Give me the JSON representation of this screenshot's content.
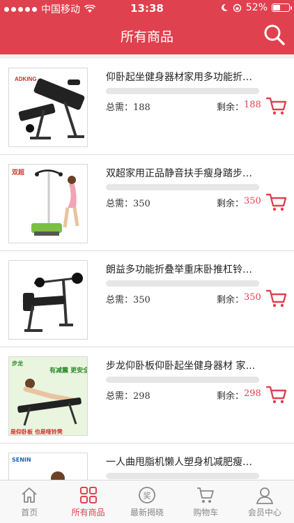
{
  "statusbar": {
    "carrier": "中国移动",
    "time": "13:38",
    "battery": "52%",
    "battery_level": 0.52
  },
  "header": {
    "title": "所有商品"
  },
  "labels": {
    "total_prefix": "总需：",
    "remain_prefix": "剩余："
  },
  "products": [
    {
      "title": "仰卧起坐健身器材家用多功能折叠...",
      "total": "188",
      "remain": "188",
      "progress": 0,
      "brand": "ADKING"
    },
    {
      "title": "双超家用正品静音扶手瘦身踏步机...",
      "total": "350",
      "remain": "350",
      "progress": 0,
      "brand": "双超"
    },
    {
      "title": "朗益多功能折叠举重床卧推杠铃床...",
      "total": "350",
      "remain": "350",
      "progress": 0,
      "brand": ""
    },
    {
      "title": "步龙仰卧板仰卧起坐健身器材 家用...",
      "total": "298",
      "remain": "298",
      "progress": 0,
      "brand": "步龙",
      "promo_top": "有减震 更安全",
      "promo_bottom": "是仰卧板 也是哑铃凳"
    },
    {
      "title": "一人曲甩脂机懒人塑身机减肥瘦身...",
      "total": "",
      "remain": "",
      "progress": 0,
      "brand": "SENIN"
    }
  ],
  "tabbar": [
    {
      "label": "首页",
      "icon": "home-icon",
      "active": false
    },
    {
      "label": "所有商品",
      "icon": "grid-icon",
      "active": true
    },
    {
      "label": "最新揭晓",
      "icon": "award-icon",
      "active": false
    },
    {
      "label": "购物车",
      "icon": "cart-icon",
      "active": false
    },
    {
      "label": "会员中心",
      "icon": "user-icon",
      "active": false
    }
  ],
  "colors": {
    "accent": "#e0414e"
  }
}
